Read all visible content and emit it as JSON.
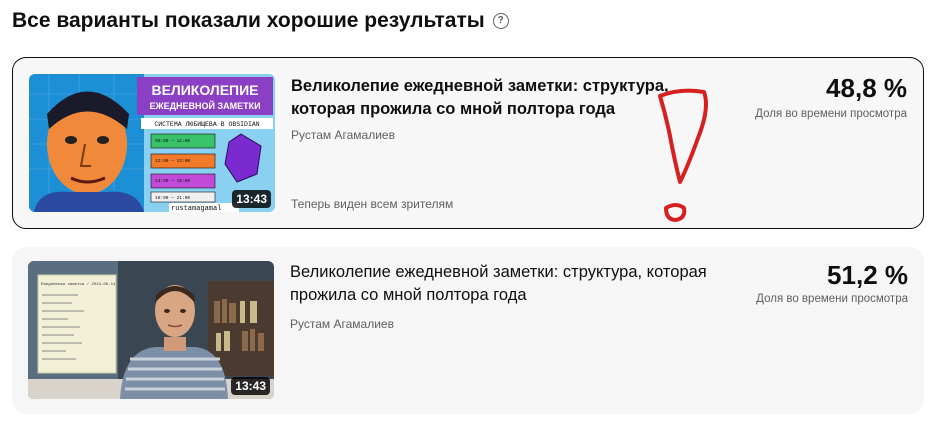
{
  "header": {
    "title": "Все варианты показали хорошие результаты",
    "help_icon": "question-mark"
  },
  "variants": [
    {
      "title": "Великолепие ежедневной заметки: структура, которая прожила со мной полтора года",
      "author": "Рустам Агамалиев",
      "duration": "13:43",
      "visibility": "Теперь виден всем зрителям",
      "percent": "48,8 %",
      "metric_label": "Доля во времени просмотра",
      "thumbnail": {
        "title_line1": "ВЕЛИКОЛЕПИЕ",
        "title_line2": "ЕЖЕДНЕВНОЙ ЗАМЕТКИ",
        "subtitle": "СИСТЕМА ЛЮБИЩЕВА В OBSIDIAN",
        "watermark": "rustamagamal",
        "times": [
          "09:00 — 12:00",
          "12:00 — 13:00",
          "13:00 — 18:00",
          "18:00 — 21:00"
        ]
      }
    },
    {
      "title": "Великолепие ежедневной заметки: структура, которая прожила со мной полтора года",
      "author": "Рустам Агамалиев",
      "duration": "13:43",
      "percent": "51,2 %",
      "metric_label": "Доля во времени просмотра",
      "thumbnail": {
        "screen_heading": "Ежедневная заметка / 2024-06-14"
      }
    }
  ],
  "colors": {
    "annotation": "#d62020",
    "card_bg": "#f6f6f6",
    "selected_border": "#0f0f0f"
  }
}
